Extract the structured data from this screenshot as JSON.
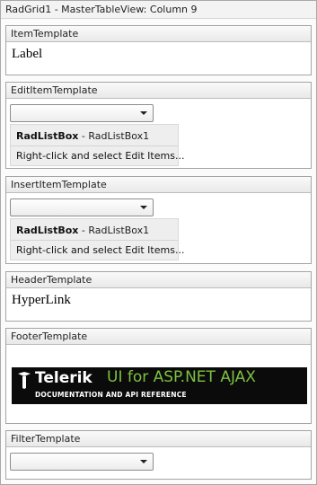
{
  "window": {
    "title": "RadGrid1 - MasterTableView: Column 9"
  },
  "sections": {
    "item": {
      "header": "ItemTemplate",
      "label": "Label"
    },
    "edit": {
      "header": "EditItemTemplate",
      "combo_value": "",
      "control_type": "RadListBox",
      "control_id": " - RadListBox1",
      "hint": "Right-click and select Edit Items..."
    },
    "insert": {
      "header": "InsertItemTemplate",
      "combo_value": "",
      "control_type": "RadListBox",
      "control_id": " - RadListBox1",
      "hint": "Right-click and select Edit Items..."
    },
    "header_tpl": {
      "header": "HeaderTemplate",
      "link": "HyperLink"
    },
    "footer": {
      "header": "FooterTemplate",
      "banner": {
        "brand": "Telerik",
        "product": "UI for ASP.NET AJAX",
        "subtitle": "DOCUMENTATION AND API REFERENCE",
        "brand_color": "#ffffff",
        "product_color": "#7dc142",
        "background": "#0b0b0b"
      }
    },
    "filter": {
      "header": "FilterTemplate",
      "combo_value": ""
    }
  },
  "icons": {
    "dropdown": "chevron-down-icon",
    "logo": "telerik-logo-icon"
  }
}
